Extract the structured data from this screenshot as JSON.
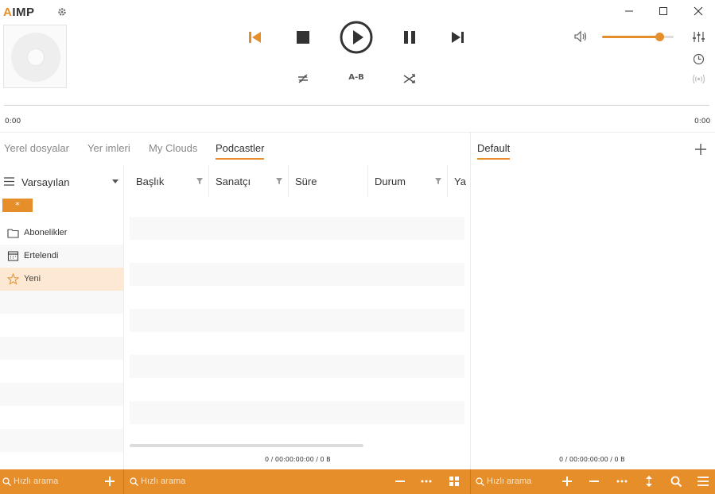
{
  "app": {
    "logo_prefix": "A",
    "logo_rest": "IMP"
  },
  "player": {
    "time_current": "0:00",
    "time_total": "0:00",
    "ab_label": "A-B",
    "volume": 0.8
  },
  "tabs": [
    {
      "label": "Yerel dosyalar",
      "active": false
    },
    {
      "label": "Yer imleri",
      "active": false
    },
    {
      "label": "My Clouds",
      "active": false
    },
    {
      "label": "Podcastler",
      "active": true
    }
  ],
  "playlist": {
    "tab_label": "Default",
    "status": "0 / 00:00:00:00 / 0 B"
  },
  "tree": {
    "title": "Varsayılan",
    "filter_label": "*",
    "items": [
      {
        "label": "Abonelikler",
        "icon": "folder-icon",
        "selected": false
      },
      {
        "label": "Ertelendi",
        "icon": "calendar-icon",
        "selected": false
      },
      {
        "label": "Yeni",
        "icon": "star-icon",
        "selected": true
      }
    ]
  },
  "table": {
    "columns": [
      {
        "label": "Başlık"
      },
      {
        "label": "Sanatçı"
      },
      {
        "label": "Süre"
      },
      {
        "label": "Durum"
      },
      {
        "label": "Ya"
      }
    ],
    "status": "0 / 00:00:00:00 / 0 B"
  },
  "search": {
    "placeholder_left": "Hızlı arama",
    "placeholder_middle": "Hızlı arama",
    "placeholder_right": "Hızlı arama"
  },
  "colors": {
    "accent": "#e58e2a",
    "selected_bg": "#fde8d4"
  }
}
